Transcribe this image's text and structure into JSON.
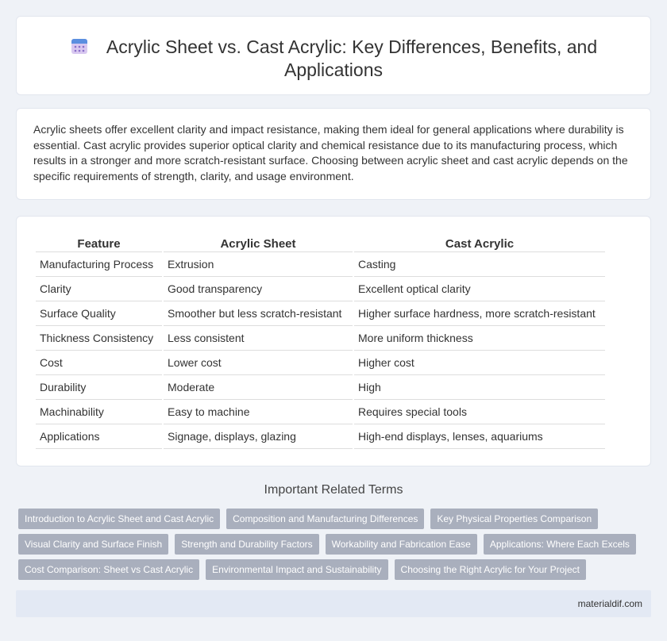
{
  "header": {
    "title": "Acrylic Sheet vs. Cast Acrylic: Key Differences, Benefits, and Applications",
    "icon": "calendar-icon"
  },
  "intro": {
    "text": "Acrylic sheets offer excellent clarity and impact resistance, making them ideal for general applications where durability is essential. Cast acrylic provides superior optical clarity and chemical resistance due to its manufacturing process, which results in a stronger and more scratch-resistant surface. Choosing between acrylic sheet and cast acrylic depends on the specific requirements of strength, clarity, and usage environment."
  },
  "table": {
    "headers": [
      "Feature",
      "Acrylic Sheet",
      "Cast Acrylic"
    ],
    "rows": [
      [
        "Manufacturing Process",
        "Extrusion",
        "Casting"
      ],
      [
        "Clarity",
        "Good transparency",
        "Excellent optical clarity"
      ],
      [
        "Surface Quality",
        "Smoother but less scratch-resistant",
        "Higher surface hardness, more scratch-resistant"
      ],
      [
        "Thickness Consistency",
        "Less consistent",
        "More uniform thickness"
      ],
      [
        "Cost",
        "Lower cost",
        "Higher cost"
      ],
      [
        "Durability",
        "Moderate",
        "High"
      ],
      [
        "Machinability",
        "Easy to machine",
        "Requires special tools"
      ],
      [
        "Applications",
        "Signage, displays, glazing",
        "High-end displays, lenses, aquariums"
      ]
    ]
  },
  "related": {
    "title": "Important Related Terms",
    "rows": [
      [
        "Introduction to Acrylic Sheet and Cast Acrylic",
        "Composition and Manufacturing Differences",
        "Key Physical Properties Comparison"
      ],
      [
        "Visual Clarity and Surface Finish",
        "Strength and Durability Factors",
        "Workability and Fabrication Ease",
        "Applications: Where Each Excels"
      ],
      [
        "Cost Comparison: Sheet vs Cast Acrylic",
        "Environmental Impact and Sustainability",
        "Choosing the Right Acrylic for Your Project"
      ]
    ]
  },
  "footer": {
    "site": "materialdif.com"
  }
}
